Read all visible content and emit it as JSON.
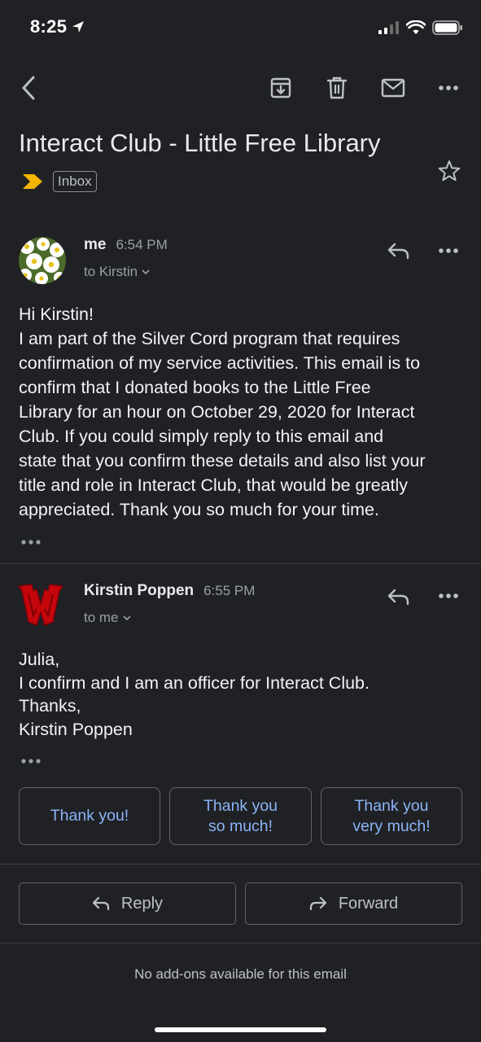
{
  "status_bar": {
    "time": "8:25"
  },
  "email": {
    "subject": "Interact Club - Little Free Library",
    "label": "Inbox"
  },
  "messages": [
    {
      "sender": "me",
      "time": "6:54 PM",
      "recipient": "to Kirstin",
      "body": "Hi Kirstin!\nI am part of the Silver Cord program that requires\nconfirmation of my service activities. This email is to\nconfirm that I donated books to the Little Free\nLibrary  for an hour on October 29, 2020 for Interact\nClub. If you could simply reply to this email and\nstate that you confirm these details and also list your\ntitle and role in Interact Club, that would be greatly\nappreciated. Thank you so much for your time."
    },
    {
      "sender": "Kirstin Poppen",
      "time": "6:55 PM",
      "recipient": "to me",
      "body": "Julia,\nI confirm and I am an officer for Interact Club.\nThanks,\nKirstin Poppen"
    }
  ],
  "smart_replies": [
    "Thank you!",
    "Thank you\nso much!",
    "Thank you\nvery much!"
  ],
  "actions": {
    "reply": "Reply",
    "forward": "Forward"
  },
  "footer": {
    "addons": "No add-ons available for this email"
  },
  "colors": {
    "background": "#202124",
    "accent": "#8ab4f8",
    "label_arrow": "#f4b400",
    "badge_red": "#c5050c"
  }
}
